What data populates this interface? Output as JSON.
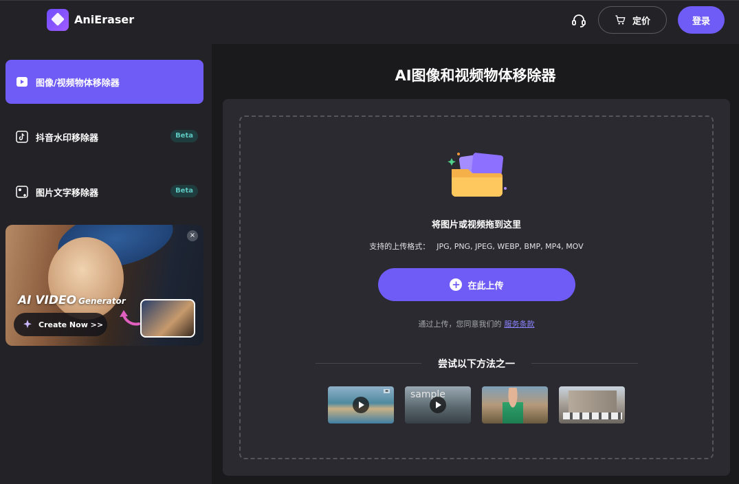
{
  "header": {
    "brand": "AniEraser",
    "pricing_label": "定价",
    "login_label": "登录",
    "icons": [
      "headset-icon",
      "cart-icon"
    ],
    "accent_color": "#6f5cf6"
  },
  "sidebar": {
    "items": [
      {
        "label": "图像/视频物体移除器",
        "icon": "play-square-icon",
        "active": true,
        "badge": ""
      },
      {
        "label": "抖音水印移除器",
        "icon": "tiktok-icon",
        "active": false,
        "badge": "Beta"
      },
      {
        "label": "图片文字移除器",
        "icon": "image-text-icon",
        "active": false,
        "badge": "Beta"
      }
    ],
    "promo": {
      "title": "AI VIDEO",
      "title_suffix": "Generator",
      "cta": "Create Now >>",
      "close": "×"
    }
  },
  "main": {
    "title": "AI图像和视频物体移除器",
    "drop_text": "将图片或视频拖到这里",
    "formats_label": "支持的上传格式：",
    "formats": "JPG, PNG, JPEG, WEBP, BMP, MP4, MOV",
    "upload_label": "在此上传",
    "terms_prefix": "通过上传，您同意我们的",
    "terms_link": "服务条款",
    "try_label": "尝试以下方法之一",
    "samples": [
      {
        "type": "video",
        "alt": ""
      },
      {
        "type": "video",
        "alt": "sample"
      },
      {
        "type": "image",
        "alt": ""
      },
      {
        "type": "image",
        "alt": ""
      }
    ]
  }
}
